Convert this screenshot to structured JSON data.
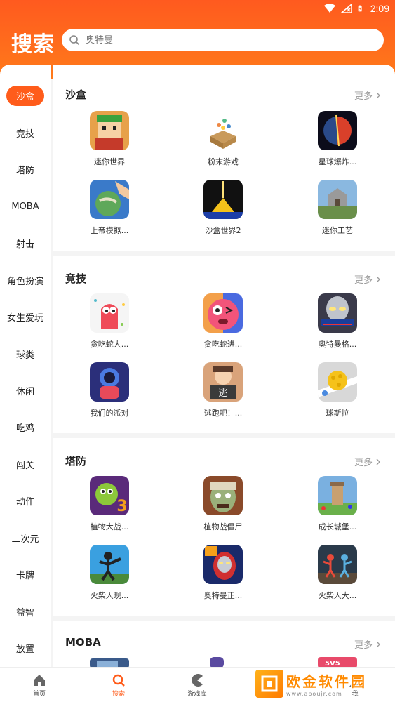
{
  "status_bar": {
    "time": "2:09"
  },
  "header": {
    "title": "搜索",
    "search_placeholder": "奥特曼"
  },
  "sidebar": {
    "items": [
      {
        "label": "沙盒",
        "active": true
      },
      {
        "label": "竞技"
      },
      {
        "label": "塔防"
      },
      {
        "label": "MOBA"
      },
      {
        "label": "射击"
      },
      {
        "label": "角色扮演"
      },
      {
        "label": "女生爱玩"
      },
      {
        "label": "球类"
      },
      {
        "label": "休闲"
      },
      {
        "label": "吃鸡"
      },
      {
        "label": "闯关"
      },
      {
        "label": "动作"
      },
      {
        "label": "二次元"
      },
      {
        "label": "卡牌"
      },
      {
        "label": "益智"
      },
      {
        "label": "放置"
      }
    ]
  },
  "sections": [
    {
      "title": "沙盒",
      "more": "更多",
      "games": [
        {
          "name": "迷你世界",
          "icon": "mini-world-icon"
        },
        {
          "name": "粉末游戏",
          "icon": "powder-game-icon"
        },
        {
          "name": "星球爆炸...",
          "icon": "planet-explode-icon"
        },
        {
          "name": "上帝模拟...",
          "icon": "god-simulator-icon"
        },
        {
          "name": "沙盒世界2",
          "icon": "sandbox-world-icon"
        },
        {
          "name": "迷你工艺",
          "icon": "mini-craft-icon"
        }
      ]
    },
    {
      "title": "竞技",
      "more": "更多",
      "games": [
        {
          "name": "贪吃蛇大...",
          "icon": "snake-icon"
        },
        {
          "name": "贪吃蛇进...",
          "icon": "snake-evolve-icon"
        },
        {
          "name": "奥特曼格...",
          "icon": "ultraman-fight-icon"
        },
        {
          "name": "我们的派对",
          "icon": "our-party-icon"
        },
        {
          "name": "逃跑吧！...",
          "icon": "escape-icon"
        },
        {
          "name": "球斯拉",
          "icon": "ball-zilla-icon"
        }
      ]
    },
    {
      "title": "塔防",
      "more": "更多",
      "games": [
        {
          "name": "植物大战...",
          "icon": "pvz3-icon"
        },
        {
          "name": "植物战僵尸",
          "icon": "zombie-icon"
        },
        {
          "name": "成长城堡...",
          "icon": "grow-castle-icon"
        },
        {
          "name": "火柴人现...",
          "icon": "stickman-war-icon"
        },
        {
          "name": "奥特曼正...",
          "icon": "ultraman-icon"
        },
        {
          "name": "火柴人大...",
          "icon": "stickman-battle-icon"
        }
      ]
    },
    {
      "title": "MOBA",
      "more": "更多",
      "games": []
    }
  ],
  "bottom_nav": {
    "items": [
      {
        "label": "首页",
        "icon": "home-icon"
      },
      {
        "label": "搜索",
        "icon": "search-icon",
        "active": true
      },
      {
        "label": "游戏库",
        "icon": "game-library-icon"
      },
      {
        "label": "我",
        "icon": "profile-icon"
      }
    ]
  },
  "watermark": {
    "text": "欧金软件园",
    "url": "www.apoujr.com"
  },
  "colors": {
    "accent": "#ff5c1b",
    "header_top": "#ff5a1f",
    "header_bottom": "#ff7a1a"
  }
}
